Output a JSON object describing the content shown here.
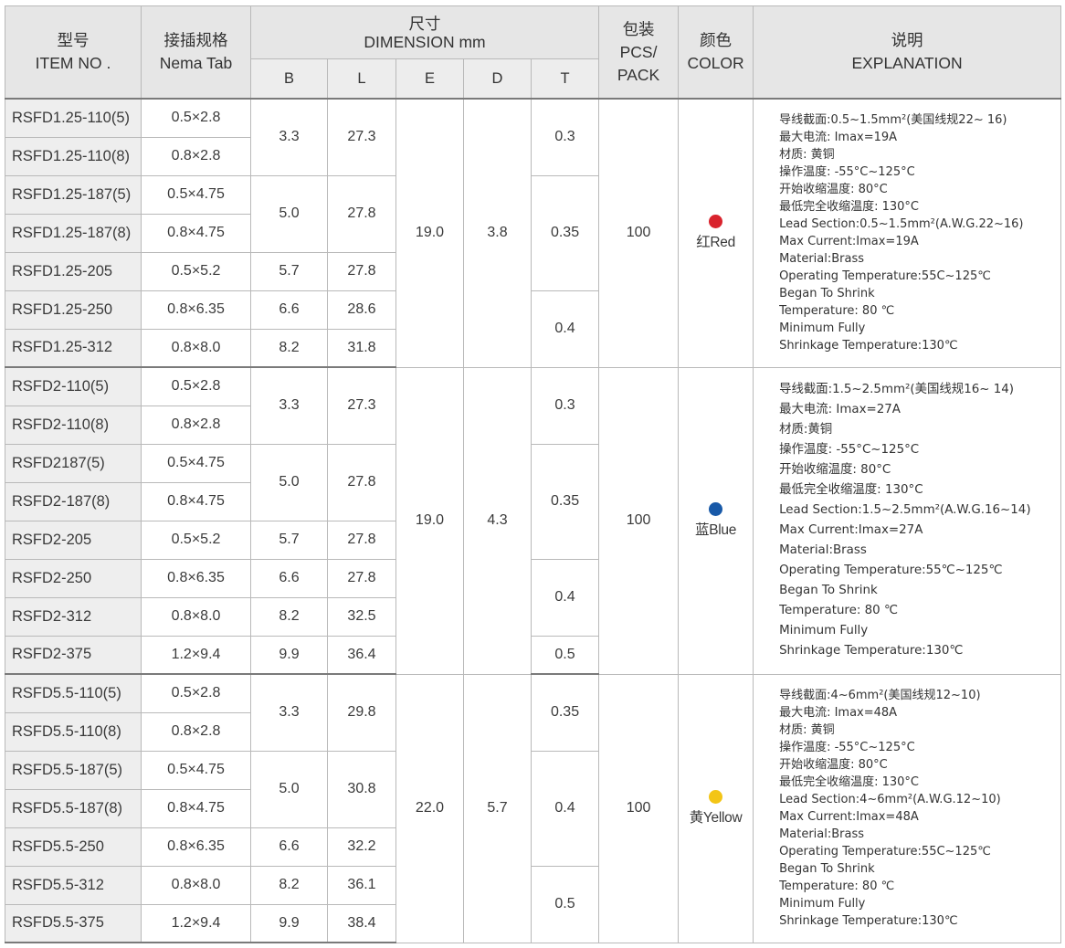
{
  "header": {
    "item": {
      "cn": "型号",
      "en": "ITEM NO ."
    },
    "nema": {
      "cn": "接插规格",
      "en": "Nema Tab"
    },
    "dimension": {
      "cn": "尺寸",
      "en": "DIMENSION mm"
    },
    "sub": {
      "b": "B",
      "l": "L",
      "e": "E",
      "d": "D",
      "t": "T"
    },
    "pack": {
      "cn": "包装",
      "en1": "PCS/",
      "en2": "PACK"
    },
    "color": {
      "cn": "颜色",
      "en": "COLOR"
    },
    "explanation": {
      "cn": "说明",
      "en": "EXPLANATION"
    }
  },
  "rows": [
    {
      "item": "RSFD1.25-110(5)",
      "nema": "0.5×2.8"
    },
    {
      "item": "RSFD1.25-110(8)",
      "nema": "0.8×2.8"
    },
    {
      "item": "RSFD1.25-187(5)",
      "nema": "0.5×4.75"
    },
    {
      "item": "RSFD1.25-187(8)",
      "nema": "0.8×4.75"
    },
    {
      "item": "RSFD1.25-205",
      "nema": "0.5×5.2"
    },
    {
      "item": "RSFD1.25-250",
      "nema": "0.8×6.35"
    },
    {
      "item": "RSFD1.25-312",
      "nema": "0.8×8.0"
    },
    {
      "item": "RSFD2-110(5)",
      "nema": "0.5×2.8"
    },
    {
      "item": "RSFD2-110(8)",
      "nema": "0.8×2.8"
    },
    {
      "item": "RSFD2187(5)",
      "nema": "0.5×4.75"
    },
    {
      "item": "RSFD2-187(8)",
      "nema": "0.8×4.75"
    },
    {
      "item": "RSFD2-205",
      "nema": "0.5×5.2"
    },
    {
      "item": "RSFD2-250",
      "nema": "0.8×6.35"
    },
    {
      "item": "RSFD2-312",
      "nema": "0.8×8.0"
    },
    {
      "item": "RSFD2-375",
      "nema": "1.2×9.4"
    },
    {
      "item": "RSFD5.5-110(5)",
      "nema": "0.5×2.8"
    },
    {
      "item": "RSFD5.5-110(8)",
      "nema": "0.8×2.8"
    },
    {
      "item": "RSFD5.5-187(5)",
      "nema": "0.5×4.75"
    },
    {
      "item": "RSFD5.5-187(8)",
      "nema": "0.8×4.75"
    },
    {
      "item": "RSFD5.5-250",
      "nema": "0.8×6.35"
    },
    {
      "item": "RSFD5.5-312",
      "nema": "0.8×8.0"
    },
    {
      "item": "RSFD5.5-375",
      "nema": "1.2×9.4"
    }
  ],
  "bl": [
    {
      "b": "3.3",
      "l": "27.3"
    },
    {
      "b": "5.0",
      "l": "27.8"
    },
    {
      "b": "5.7",
      "l": "27.8"
    },
    {
      "b": "6.6",
      "l": "28.6"
    },
    {
      "b": "8.2",
      "l": "31.8"
    },
    {
      "b": "3.3",
      "l": "27.3"
    },
    {
      "b": "5.0",
      "l": "27.8"
    },
    {
      "b": "5.7",
      "l": "27.8"
    },
    {
      "b": "6.6",
      "l": "27.8"
    },
    {
      "b": "8.2",
      "l": "32.5"
    },
    {
      "b": "9.9",
      "l": "36.4"
    },
    {
      "b": "3.3",
      "l": "29.8"
    },
    {
      "b": "5.0",
      "l": "30.8"
    },
    {
      "b": "6.6",
      "l": "32.2"
    },
    {
      "b": "8.2",
      "l": "36.1"
    },
    {
      "b": "9.9",
      "l": "38.4"
    }
  ],
  "t": [
    "0.3",
    "0.35",
    "0.4",
    "0.3",
    "0.35",
    "0.4",
    "0.5",
    "0.35",
    "0.4",
    "0.5"
  ],
  "groups": [
    {
      "e": "19.0",
      "d": "3.8",
      "pack": "100",
      "color_label": "红Red",
      "color_hex": "#d9232d",
      "color_icon": "red-dot-icon",
      "explanation": [
        "导线截面:0.5~1.5mm²(美国线规22~ 16)",
        "最大电流: Imax=19A",
        "材质: 黄铜",
        "操作温度: -55°C~125°C",
        "开始收缩温度: 80°C",
        "最低完全收缩温度: 130°C",
        "Lead Section:0.5~1.5mm²(A.W.G.22~16)",
        "Max Current:Imax=19A",
        "Material:Brass",
        "Operating Temperature:55C~125℃",
        "Began To Shrink",
        "Temperature: 80 ℃",
        "Minimum Fully",
        "Shrinkage Temperature:130℃"
      ]
    },
    {
      "e": "19.0",
      "d": "4.3",
      "pack": "100",
      "color_label": "蓝Blue",
      "color_hex": "#1859a8",
      "color_icon": "blue-dot-icon",
      "explanation": [
        "导线截面:1.5~2.5mm²(美国线规16~ 14)",
        "最大电流: Imax=27A",
        "材质:黄铜",
        "操作温度: -55°C~125°C",
        "开始收缩温度: 80°C",
        "最低完全收缩温度: 130°C",
        "Lead Section:1.5~2.5mm²(A.W.G.16~14)",
        "Max Current:Imax=27A",
        "Material:Brass",
        "Operating Temperature:55℃~125℃",
        "Began To Shrink",
        "Temperature: 80 ℃",
        "Minimum Fully",
        "Shrinkage Temperature:130℃"
      ]
    },
    {
      "e": "22.0",
      "d": "5.7",
      "pack": "100",
      "color_label": "黄Yellow",
      "color_hex": "#f3c516",
      "color_icon": "yellow-dot-icon",
      "explanation": [
        "导线截面:4~6mm²(美国线规12~10)",
        "最大电流: Imax=48A",
        "材质: 黄铜",
        "操作温度: -55°C~125°C",
        "开始收缩温度: 80°C",
        "最低完全收缩温度: 130°C",
        "Lead Section:4~6mm²(A.W.G.12~10)",
        "Max Current:Imax=48A",
        "Material:Brass",
        "Operating Temperature:55C~125℃",
        "Began To Shrink",
        "Temperature: 80 ℃",
        "Minimum Fully",
        "Shrinkage Temperature:130℃"
      ]
    }
  ]
}
